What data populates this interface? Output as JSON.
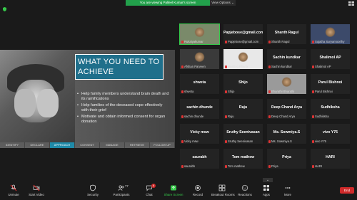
{
  "banner": {
    "text": "You are viewing Palleel Kumar's screen",
    "view_options": "View Options ⌄"
  },
  "slide": {
    "title": "WHAT YOU NEED TO ACHIEVE",
    "bullets": [
      "Help family members understand brain death and its ramifications",
      "Help families of the deceased cope effectively with their grief",
      "Motivate and obtain informed consent for organ donation"
    ],
    "nav": [
      "IDENTIFY",
      "DECLARE",
      "APPROACH",
      "CONSENT",
      "MANAGE",
      "RETRIEVE",
      "FOLLOW UP"
    ],
    "active_nav": "APPROACH"
  },
  "participants": [
    {
      "name": "",
      "sub": "Rukaiyakumar",
      "video": true,
      "color": "#7a8a6a",
      "speaker": true
    },
    {
      "name": "Papjebose@gmail.com",
      "sub": "Papjebose@gmail.com",
      "video": false
    },
    {
      "name": "Shanth Ragul",
      "sub": "Shanth Ragul",
      "video": false
    },
    {
      "name": "",
      "sub": "Sujatha Suryamoorthy",
      "video": true,
      "color": "#3c4a6a"
    },
    {
      "name": "",
      "sub": "Afshan Parveen",
      "video": true,
      "color": "#3a3a3a"
    },
    {
      "name": "",
      "sub": "Menting Pharla",
      "video": true,
      "color": "#e8e8e8"
    },
    {
      "name": "Sachin kundkar",
      "sub": "Sachin kundkar",
      "video": false
    },
    {
      "name": "Shalimol AP",
      "sub": "Shalimol AP",
      "video": false
    },
    {
      "name": "shweta",
      "sub": "shweta",
      "video": false
    },
    {
      "name": "Shijo",
      "sub": "Shijo",
      "video": false
    },
    {
      "name": "",
      "sub": "Bharathi Bharathi",
      "video": true,
      "color": "#9a9a9a"
    },
    {
      "name": "Parul Bishnoi",
      "sub": "Parul Bishnoi",
      "video": false
    },
    {
      "name": "sachin dhunde",
      "sub": "sachin dhunde",
      "video": false
    },
    {
      "name": "Raju",
      "sub": "Raju",
      "video": false
    },
    {
      "name": "Deep Chand Arya",
      "sub": "Deep Chand Arya",
      "video": false
    },
    {
      "name": "Sudhiksha",
      "sub": "Sudhiksha",
      "video": false
    },
    {
      "name": "Vicky msw",
      "sub": "Vicky msw",
      "video": false
    },
    {
      "name": "Sruthy Seenivasan",
      "sub": "Sruthy Seenivasan",
      "video": false
    },
    {
      "name": "Ms. Sowmiya.S",
      "sub": "Ms. Sowmiya.S",
      "video": false
    },
    {
      "name": "vivo Y75",
      "sub": "vivo Y75",
      "video": false
    },
    {
      "name": "saurabh",
      "sub": "saurabh",
      "video": false
    },
    {
      "name": "Tom mathew",
      "sub": "Tom mathew",
      "video": false
    },
    {
      "name": "Priya",
      "sub": "Priya",
      "video": false
    },
    {
      "name": "HARI",
      "sub": "HARI",
      "video": false
    }
  ],
  "toolbar": {
    "unmute": "Unmute",
    "start_video": "Start Video",
    "security": "Security",
    "participants": "Participants",
    "participant_count": "77",
    "chat": "Chat",
    "chat_badge": "6",
    "share_screen": "Share Screen",
    "record": "Record",
    "breakout_rooms": "Breakout Rooms",
    "reactions": "Reactions",
    "apps": "Apps",
    "more": "More",
    "end": "End"
  },
  "colors": {
    "green": "#36c94a",
    "end_red": "#d02a2a",
    "slide_title_bg": "#1f6f8b"
  }
}
